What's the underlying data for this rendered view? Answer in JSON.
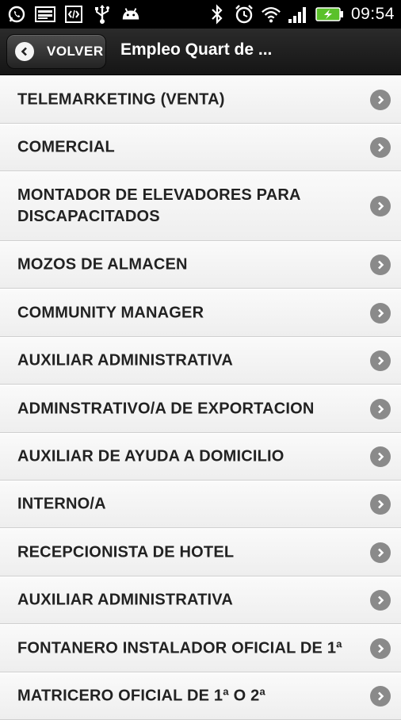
{
  "statusbar": {
    "time": "09:54",
    "left_icons": [
      "whatsapp-icon",
      "image-icon",
      "code-icon",
      "usb-icon",
      "android-icon"
    ],
    "right_icons": [
      "bluetooth-icon",
      "alarm-icon",
      "wifi-icon",
      "signal-icon",
      "battery-charging-icon"
    ]
  },
  "actionbar": {
    "back_label": "VOLVER",
    "title": "Empleo Quart de ..."
  },
  "list": {
    "items": [
      {
        "label": "TELEMARKETING (VENTA)"
      },
      {
        "label": "COMERCIAL"
      },
      {
        "label": "MONTADOR DE ELEVADORES PARA DISCAPACITADOS"
      },
      {
        "label": "MOZOS DE ALMACEN"
      },
      {
        "label": "COMMUNITY MANAGER"
      },
      {
        "label": "AUXILIAR ADMINISTRATIVA"
      },
      {
        "label": "ADMINSTRATIVO/A DE EXPORTACION"
      },
      {
        "label": "AUXILIAR DE AYUDA A DOMICILIO"
      },
      {
        "label": "INTERNO/A"
      },
      {
        "label": "RECEPCIONISTA DE HOTEL"
      },
      {
        "label": "AUXILIAR ADMINISTRATIVA"
      },
      {
        "label": "FONTANERO INSTALADOR OFICIAL DE 1ª"
      },
      {
        "label": "MATRICERO OFICIAL DE 1ª O 2ª"
      }
    ]
  },
  "colors": {
    "statusbar_bg": "#000000",
    "actionbar_bg": "#1f1f1f",
    "list_bg": "#f2f2f2",
    "chevron": "#8a8a8a",
    "battery": "#5ac12a"
  }
}
